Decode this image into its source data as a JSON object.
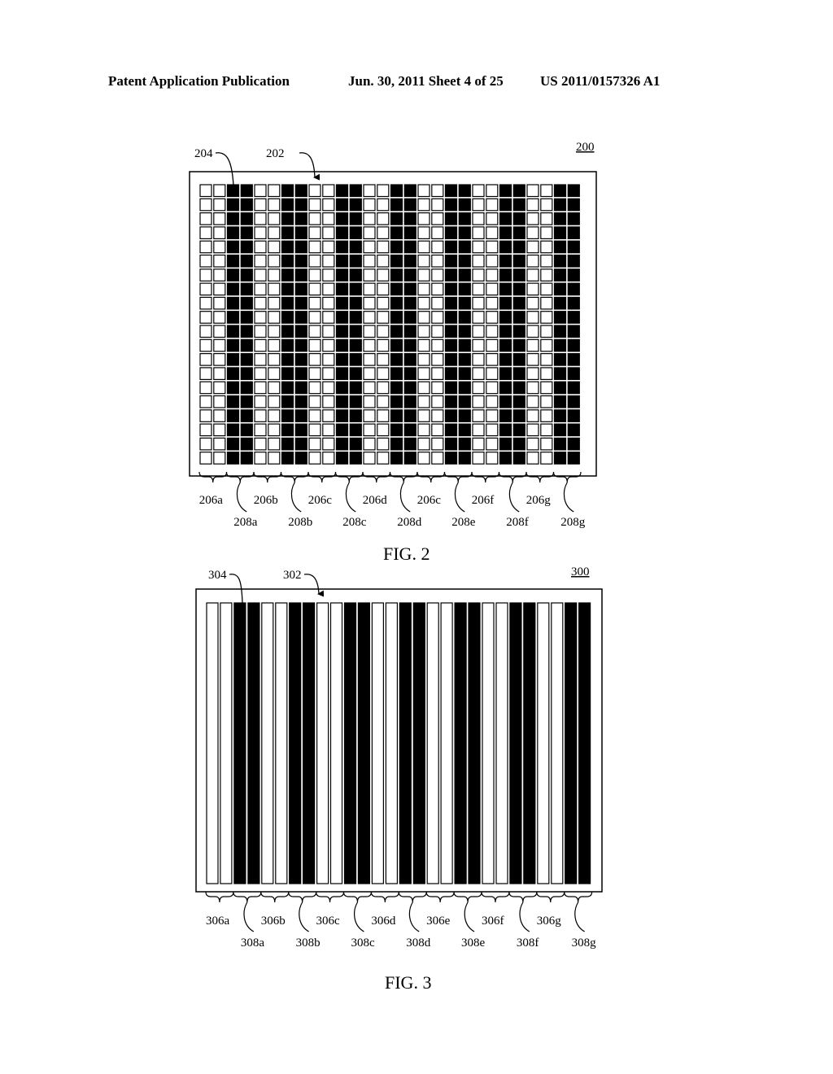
{
  "header": {
    "publication": "Patent Application Publication",
    "date_sheet": "Jun. 30, 2011  Sheet 4 of 25",
    "patent_number": "US 2011/0157326 A1"
  },
  "fig2": {
    "caption": "FIG. 2",
    "ref_number": "200",
    "callouts": {
      "black_column": "204",
      "white_column": "202"
    },
    "grid": {
      "rows": 20,
      "column_pattern": [
        "white",
        "white",
        "black",
        "black",
        "white",
        "white",
        "black",
        "black",
        "white",
        "white",
        "black",
        "black",
        "white",
        "white",
        "black",
        "black",
        "white",
        "white",
        "black",
        "black",
        "white",
        "white",
        "black",
        "black",
        "white",
        "white",
        "black",
        "black"
      ]
    },
    "group_labels_top": [
      "206a",
      "206b",
      "206c",
      "206d",
      "206c",
      "206f",
      "206g"
    ],
    "group_labels_bottom": [
      "208a",
      "208b",
      "208c",
      "208d",
      "208e",
      "208f",
      "208g"
    ]
  },
  "fig3": {
    "caption": "FIG. 3",
    "ref_number": "300",
    "callouts": {
      "black_column": "304",
      "white_column": "302"
    },
    "column_pattern": [
      "white",
      "white",
      "black",
      "black",
      "white",
      "white",
      "black",
      "black",
      "white",
      "white",
      "black",
      "black",
      "white",
      "white",
      "black",
      "black",
      "white",
      "white",
      "black",
      "black",
      "white",
      "white",
      "black",
      "black",
      "white",
      "white",
      "black",
      "black"
    ],
    "group_labels_top": [
      "306a",
      "306b",
      "306c",
      "306d",
      "306e",
      "306f",
      "306g"
    ],
    "group_labels_bottom": [
      "308a",
      "308b",
      "308c",
      "308d",
      "308e",
      "308f",
      "308g"
    ]
  }
}
